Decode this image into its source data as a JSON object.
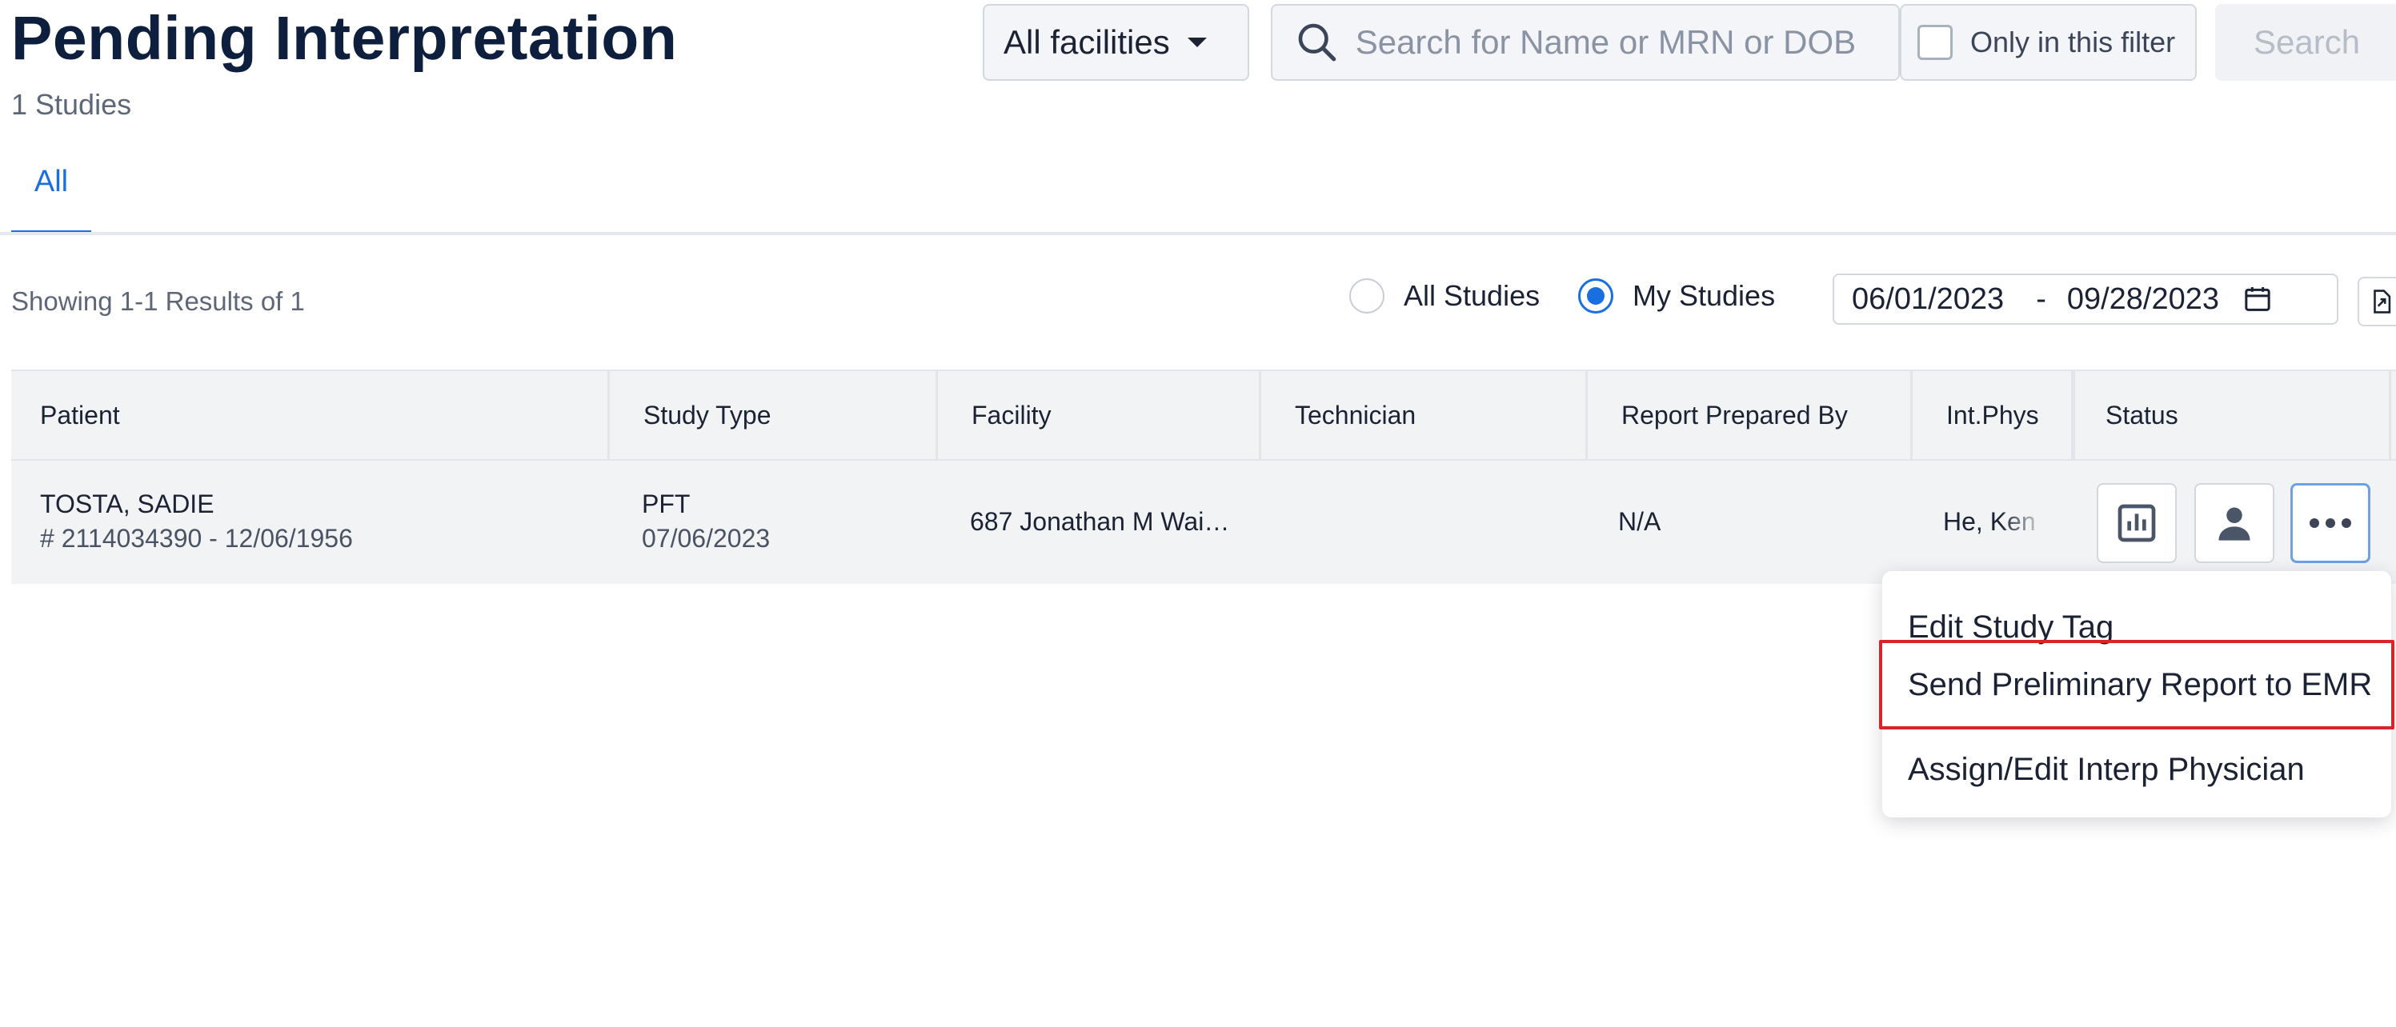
{
  "header": {
    "title": "Pending Interpretation",
    "studies_count": "1 Studies",
    "facility_select": "All facilities",
    "search_placeholder": "Search for Name or MRN or DOB",
    "only_filter_label": "Only in this filter",
    "search_button": "Search"
  },
  "tabs": [
    {
      "label": "All",
      "active": true
    }
  ],
  "filters": {
    "results_text": "Showing 1-1 Results of 1",
    "scope_options": [
      {
        "label": "All Studies",
        "selected": false
      },
      {
        "label": "My Studies",
        "selected": true
      }
    ],
    "date_from": "06/01/2023",
    "date_sep": "-",
    "date_to": "09/28/2023"
  },
  "table": {
    "columns": [
      "Patient",
      "Study Type",
      "Facility",
      "Technician",
      "Report Prepared By",
      "Int.Phys",
      "Status"
    ],
    "rows": [
      {
        "patient_name": "TOSTA, SADIE",
        "patient_meta": "# 2114034390 - 12/06/1956",
        "study_type": "PFT",
        "study_date": "07/06/2023",
        "facility": "687 Jonathan M Wai…",
        "technician": "",
        "report_prepared_by": "N/A",
        "int_phys": "He, Ken"
      }
    ]
  },
  "row_actions": [
    "chart-icon",
    "person-icon",
    "more-icon"
  ],
  "menu": {
    "items": [
      "Edit Study Tag",
      "Send Preliminary Report to EMR",
      "Assign/Edit Interp Physician"
    ],
    "highlighted_index": 1
  },
  "colors": {
    "primary": "#1a6fe0",
    "title": "#0e1f3d",
    "highlight_border": "#d8242b"
  }
}
